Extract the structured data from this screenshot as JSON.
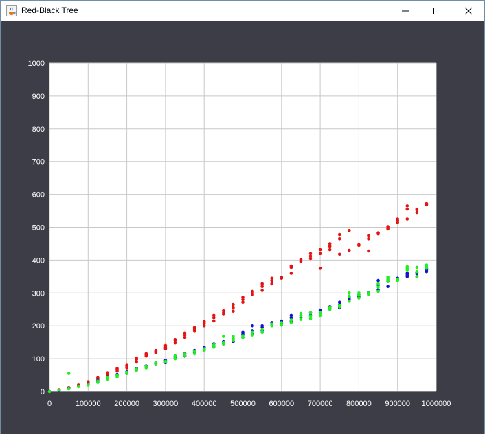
{
  "window": {
    "title": "Red-Black Tree",
    "icon": "java-cup-icon",
    "controls": [
      "minimize-icon",
      "maximize-icon",
      "close-icon"
    ]
  },
  "colors": {
    "background": "#3c3d46",
    "plot_area": "#ffffff",
    "grid": "#c8c8c8",
    "series_red": "#e31414",
    "series_blue": "#1414cc",
    "series_green": "#22ee22"
  },
  "chart_data": {
    "type": "scatter",
    "title": "",
    "xlabel": "",
    "ylabel": "",
    "xlim": [
      0,
      1000000
    ],
    "ylim": [
      0,
      1000
    ],
    "grid": true,
    "legend": "none",
    "x_ticks": [
      "0",
      "100000",
      "200000",
      "300000",
      "400000",
      "500000",
      "600000",
      "700000",
      "800000",
      "900000",
      "1000000"
    ],
    "y_ticks": [
      "0",
      "100",
      "200",
      "300",
      "400",
      "500",
      "600",
      "700",
      "800",
      "900",
      "1000"
    ],
    "series": [
      {
        "color": "#e31414",
        "points": [
          [
            0,
            0
          ],
          [
            25000,
            5
          ],
          [
            50000,
            12
          ],
          [
            75000,
            20
          ],
          [
            100000,
            28
          ],
          [
            100000,
            30
          ],
          [
            125000,
            38
          ],
          [
            125000,
            42
          ],
          [
            150000,
            50
          ],
          [
            150000,
            57
          ],
          [
            175000,
            62
          ],
          [
            175000,
            67
          ],
          [
            175000,
            70
          ],
          [
            200000,
            72
          ],
          [
            200000,
            78
          ],
          [
            200000,
            80
          ],
          [
            225000,
            90
          ],
          [
            225000,
            98
          ],
          [
            225000,
            102
          ],
          [
            250000,
            108
          ],
          [
            250000,
            112
          ],
          [
            250000,
            115
          ],
          [
            275000,
            118
          ],
          [
            275000,
            122
          ],
          [
            275000,
            125
          ],
          [
            300000,
            130
          ],
          [
            300000,
            135
          ],
          [
            300000,
            140
          ],
          [
            325000,
            148
          ],
          [
            325000,
            155
          ],
          [
            325000,
            158
          ],
          [
            350000,
            165
          ],
          [
            350000,
            172
          ],
          [
            350000,
            178
          ],
          [
            375000,
            185
          ],
          [
            375000,
            190
          ],
          [
            375000,
            195
          ],
          [
            400000,
            200
          ],
          [
            400000,
            208
          ],
          [
            400000,
            214
          ],
          [
            425000,
            215
          ],
          [
            425000,
            225
          ],
          [
            425000,
            232
          ],
          [
            450000,
            235
          ],
          [
            450000,
            240
          ],
          [
            450000,
            246
          ],
          [
            475000,
            245
          ],
          [
            475000,
            255
          ],
          [
            475000,
            265
          ],
          [
            500000,
            272
          ],
          [
            500000,
            280
          ],
          [
            500000,
            287
          ],
          [
            525000,
            295
          ],
          [
            525000,
            300
          ],
          [
            525000,
            305
          ],
          [
            550000,
            308
          ],
          [
            550000,
            320
          ],
          [
            550000,
            328
          ],
          [
            575000,
            328
          ],
          [
            575000,
            338
          ],
          [
            575000,
            345
          ],
          [
            600000,
            345
          ],
          [
            600000,
            348
          ],
          [
            625000,
            360
          ],
          [
            625000,
            378
          ],
          [
            625000,
            382
          ],
          [
            650000,
            395
          ],
          [
            650000,
            398
          ],
          [
            650000,
            402
          ],
          [
            675000,
            405
          ],
          [
            675000,
            412
          ],
          [
            675000,
            420
          ],
          [
            700000,
            375
          ],
          [
            700000,
            420
          ],
          [
            700000,
            432
          ],
          [
            725000,
            432
          ],
          [
            725000,
            442
          ],
          [
            725000,
            450
          ],
          [
            750000,
            418
          ],
          [
            750000,
            465
          ],
          [
            750000,
            478
          ],
          [
            775000,
            430
          ],
          [
            775000,
            490
          ],
          [
            800000,
            445
          ],
          [
            800000,
            447
          ],
          [
            825000,
            428
          ],
          [
            825000,
            465
          ],
          [
            825000,
            475
          ],
          [
            850000,
            480
          ],
          [
            850000,
            483
          ],
          [
            875000,
            495
          ],
          [
            875000,
            498
          ],
          [
            875000,
            502
          ],
          [
            900000,
            515
          ],
          [
            900000,
            520
          ],
          [
            900000,
            525
          ],
          [
            925000,
            525
          ],
          [
            925000,
            555
          ],
          [
            925000,
            565
          ],
          [
            950000,
            545
          ],
          [
            950000,
            552
          ],
          [
            950000,
            555
          ],
          [
            975000,
            568
          ],
          [
            975000,
            570
          ],
          [
            975000,
            572
          ]
        ]
      },
      {
        "color": "#1414cc",
        "points": [
          [
            0,
            0
          ],
          [
            25000,
            3
          ],
          [
            50000,
            10
          ],
          [
            75000,
            16
          ],
          [
            100000,
            22
          ],
          [
            125000,
            30
          ],
          [
            125000,
            34
          ],
          [
            150000,
            40
          ],
          [
            150000,
            44
          ],
          [
            175000,
            48
          ],
          [
            175000,
            52
          ],
          [
            200000,
            55
          ],
          [
            200000,
            60
          ],
          [
            225000,
            65
          ],
          [
            225000,
            70
          ],
          [
            250000,
            74
          ],
          [
            250000,
            78
          ],
          [
            275000,
            84
          ],
          [
            275000,
            88
          ],
          [
            300000,
            88
          ],
          [
            300000,
            95
          ],
          [
            325000,
            102
          ],
          [
            325000,
            108
          ],
          [
            350000,
            108
          ],
          [
            350000,
            115
          ],
          [
            375000,
            118
          ],
          [
            375000,
            125
          ],
          [
            400000,
            128
          ],
          [
            400000,
            135
          ],
          [
            425000,
            138
          ],
          [
            425000,
            145
          ],
          [
            450000,
            145
          ],
          [
            450000,
            152
          ],
          [
            475000,
            152
          ],
          [
            475000,
            160
          ],
          [
            500000,
            165
          ],
          [
            500000,
            175
          ],
          [
            500000,
            180
          ],
          [
            525000,
            175
          ],
          [
            525000,
            185
          ],
          [
            525000,
            200
          ],
          [
            550000,
            185
          ],
          [
            550000,
            195
          ],
          [
            550000,
            200
          ],
          [
            575000,
            205
          ],
          [
            575000,
            210
          ],
          [
            600000,
            208
          ],
          [
            600000,
            215
          ],
          [
            625000,
            215
          ],
          [
            625000,
            225
          ],
          [
            625000,
            232
          ],
          [
            650000,
            225
          ],
          [
            650000,
            232
          ],
          [
            675000,
            232
          ],
          [
            675000,
            240
          ],
          [
            700000,
            240
          ],
          [
            700000,
            248
          ],
          [
            725000,
            252
          ],
          [
            725000,
            258
          ],
          [
            750000,
            255
          ],
          [
            750000,
            265
          ],
          [
            750000,
            272
          ],
          [
            775000,
            280
          ],
          [
            775000,
            285
          ],
          [
            775000,
            290
          ],
          [
            800000,
            288
          ],
          [
            800000,
            295
          ],
          [
            825000,
            298
          ],
          [
            825000,
            302
          ],
          [
            850000,
            310
          ],
          [
            850000,
            325
          ],
          [
            850000,
            338
          ],
          [
            875000,
            320
          ],
          [
            875000,
            335
          ],
          [
            900000,
            340
          ],
          [
            900000,
            345
          ],
          [
            925000,
            350
          ],
          [
            925000,
            355
          ],
          [
            925000,
            360
          ],
          [
            950000,
            350
          ],
          [
            950000,
            358
          ],
          [
            950000,
            362
          ],
          [
            975000,
            365
          ],
          [
            975000,
            370
          ],
          [
            975000,
            375
          ]
        ]
      },
      {
        "color": "#22ee22",
        "points": [
          [
            0,
            0
          ],
          [
            25000,
            4
          ],
          [
            50000,
            55
          ],
          [
            50000,
            8
          ],
          [
            75000,
            15
          ],
          [
            100000,
            20
          ],
          [
            125000,
            28
          ],
          [
            125000,
            32
          ],
          [
            150000,
            38
          ],
          [
            150000,
            42
          ],
          [
            175000,
            45
          ],
          [
            175000,
            50
          ],
          [
            200000,
            55
          ],
          [
            200000,
            58
          ],
          [
            225000,
            65
          ],
          [
            225000,
            68
          ],
          [
            250000,
            72
          ],
          [
            250000,
            76
          ],
          [
            275000,
            82
          ],
          [
            275000,
            88
          ],
          [
            300000,
            90
          ],
          [
            300000,
            92
          ],
          [
            325000,
            100
          ],
          [
            325000,
            108
          ],
          [
            350000,
            110
          ],
          [
            350000,
            114
          ],
          [
            375000,
            115
          ],
          [
            375000,
            122
          ],
          [
            400000,
            125
          ],
          [
            400000,
            130
          ],
          [
            425000,
            135
          ],
          [
            425000,
            142
          ],
          [
            450000,
            145
          ],
          [
            450000,
            148
          ],
          [
            450000,
            168
          ],
          [
            475000,
            155
          ],
          [
            475000,
            162
          ],
          [
            475000,
            168
          ],
          [
            500000,
            165
          ],
          [
            500000,
            170
          ],
          [
            525000,
            172
          ],
          [
            525000,
            180
          ],
          [
            550000,
            180
          ],
          [
            550000,
            188
          ],
          [
            575000,
            200
          ],
          [
            575000,
            205
          ],
          [
            600000,
            202
          ],
          [
            600000,
            210
          ],
          [
            625000,
            210
          ],
          [
            625000,
            218
          ],
          [
            650000,
            220
          ],
          [
            650000,
            230
          ],
          [
            650000,
            238
          ],
          [
            675000,
            222
          ],
          [
            675000,
            230
          ],
          [
            675000,
            240
          ],
          [
            700000,
            232
          ],
          [
            700000,
            240
          ],
          [
            725000,
            250
          ],
          [
            725000,
            255
          ],
          [
            750000,
            258
          ],
          [
            750000,
            262
          ],
          [
            775000,
            275
          ],
          [
            775000,
            290
          ],
          [
            775000,
            300
          ],
          [
            800000,
            285
          ],
          [
            800000,
            295
          ],
          [
            800000,
            300
          ],
          [
            825000,
            295
          ],
          [
            825000,
            300
          ],
          [
            850000,
            305
          ],
          [
            850000,
            318
          ],
          [
            850000,
            328
          ],
          [
            875000,
            335
          ],
          [
            875000,
            342
          ],
          [
            875000,
            348
          ],
          [
            900000,
            338
          ],
          [
            900000,
            342
          ],
          [
            925000,
            370
          ],
          [
            925000,
            375
          ],
          [
            925000,
            380
          ],
          [
            950000,
            350
          ],
          [
            950000,
            365
          ],
          [
            950000,
            378
          ],
          [
            975000,
            375
          ],
          [
            975000,
            380
          ],
          [
            975000,
            385
          ]
        ]
      }
    ]
  }
}
